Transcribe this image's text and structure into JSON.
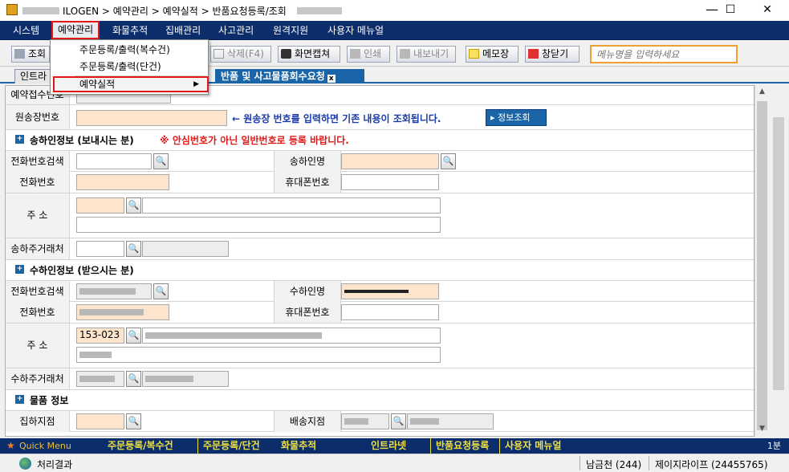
{
  "window": {
    "title": "ILOGEN > 예약관리 > 예약실적 > 반품요청등록/조회",
    "controls": {
      "minimize": "—",
      "maximize": "☐",
      "close": "✕"
    }
  },
  "menubar": {
    "items": [
      "시스템",
      "예약관리",
      "화물추적",
      "집배관리",
      "사고관리",
      "원격지원",
      "사용자 메뉴얼"
    ],
    "active": "예약관리"
  },
  "dropdown": {
    "items": [
      "주문등록/출력(복수건)",
      "주문등록/출력(단건)",
      "예약실적"
    ],
    "highlighted": "예약실적",
    "submenu_arrow": "▶"
  },
  "toolbar": {
    "query_label": "조회",
    "delete_label": "삭제(F4)",
    "capture_label": "화면캡쳐",
    "print_label": "인쇄",
    "export_label": "내보내기",
    "memo_label": "메모장",
    "close_label": "창닫기",
    "menu_search_placeholder": "메뉴명을 입력하세요"
  },
  "tabs": {
    "first": "인트라",
    "active": "반품 및 사고물품회수요청",
    "close": "x"
  },
  "form": {
    "reserve_no_label": "예약접수번호",
    "waybill_label": "원송장번호",
    "waybill_hint": "← 원송장 번호를 입력하면 기존 내용이 조회됩니다.",
    "info_query_label": "정보조회",
    "sender_section": {
      "title": "송하인정보 (보내시는 분)",
      "note": "※ 안심번호가 아닌 일반번호로 등록 바랍니다.",
      "phone_search_label": "전화번호검색",
      "name_label": "송하인명",
      "phone_label": "전화번호",
      "mobile_label": "휴대폰번호",
      "address_label": "주    소",
      "main_account_label": "송하주거래처"
    },
    "receiver_section": {
      "title": "수하인정보 (받으시는 분)",
      "phone_search_label": "전화번호검색",
      "name_label": "수하인명",
      "phone_label": "전화번호",
      "mobile_label": "휴대폰번호",
      "address_label": "주    소",
      "zip_value": "153-023",
      "main_account_label": "수하주거래처"
    },
    "goods_section": {
      "title": "물품 정보",
      "pickup_branch_label": "집하지점",
      "delivery_branch_label": "배송지점"
    }
  },
  "quickbar": {
    "label": "Quick Menu",
    "items": [
      "주문등록/복수건",
      "주문등록/단건",
      "화물추적",
      "인트라넷",
      "반품요청등록",
      "사용자 메뉴얼"
    ],
    "right": "1분"
  },
  "statusbar": {
    "result_label": "처리결과",
    "user": "남금천 (244)",
    "company": "제이지라이프 (24455765)"
  },
  "icons": {
    "search": "magnifier-icon",
    "section": "expand-plus-icon",
    "app": "app-icon",
    "globe": "globe-icon"
  },
  "colors": {
    "menubar": "#0c2d6b",
    "active_tab": "#1a64a8",
    "highlight_border": "#e01818",
    "peach_field": "#fde4cc",
    "note_red": "#e01818",
    "hint_blue": "#1a3aa8",
    "quick_yellow": "#f0e040"
  }
}
